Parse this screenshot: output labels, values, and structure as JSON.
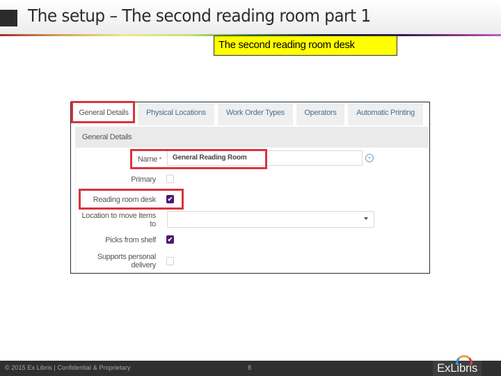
{
  "slide": {
    "title": "The setup – The second reading room part 1",
    "callout": "The second reading room desk"
  },
  "panel": {
    "tabs": [
      {
        "label": "General Details",
        "active": true
      },
      {
        "label": "Physical Locations",
        "active": false
      },
      {
        "label": "Work Order Types",
        "active": false
      },
      {
        "label": "Operators",
        "active": false
      },
      {
        "label": "Automatic Printing",
        "active": false
      }
    ],
    "section_title": "General Details",
    "fields": {
      "name": {
        "label": "Name",
        "required_mark": "*",
        "value": "General Reading Room",
        "icon": "globe-icon"
      },
      "primary": {
        "label": "Primary",
        "checked": false
      },
      "reading_room_desk": {
        "label": "Reading room desk",
        "checked": true
      },
      "location_to_move": {
        "label_line1": "Location to move items",
        "label_line2": "to",
        "value": ""
      },
      "picks_from_shelf": {
        "label": "Picks from shelf",
        "checked": true
      },
      "supports_personal_delivery": {
        "label_line1": "Supports personal",
        "label_line2": "delivery",
        "checked": false
      }
    },
    "checkmark": "✔"
  },
  "footer": {
    "copyright": "© 2015 Ex Libris | Confidential & Proprietary",
    "page_number": "8",
    "logo": "ExLibris"
  },
  "colors": {
    "highlight": "#d9343e",
    "callout_bg": "#ffff00",
    "checkbox_checked": "#4b1a73",
    "tab_text": "#4a6f8f"
  }
}
